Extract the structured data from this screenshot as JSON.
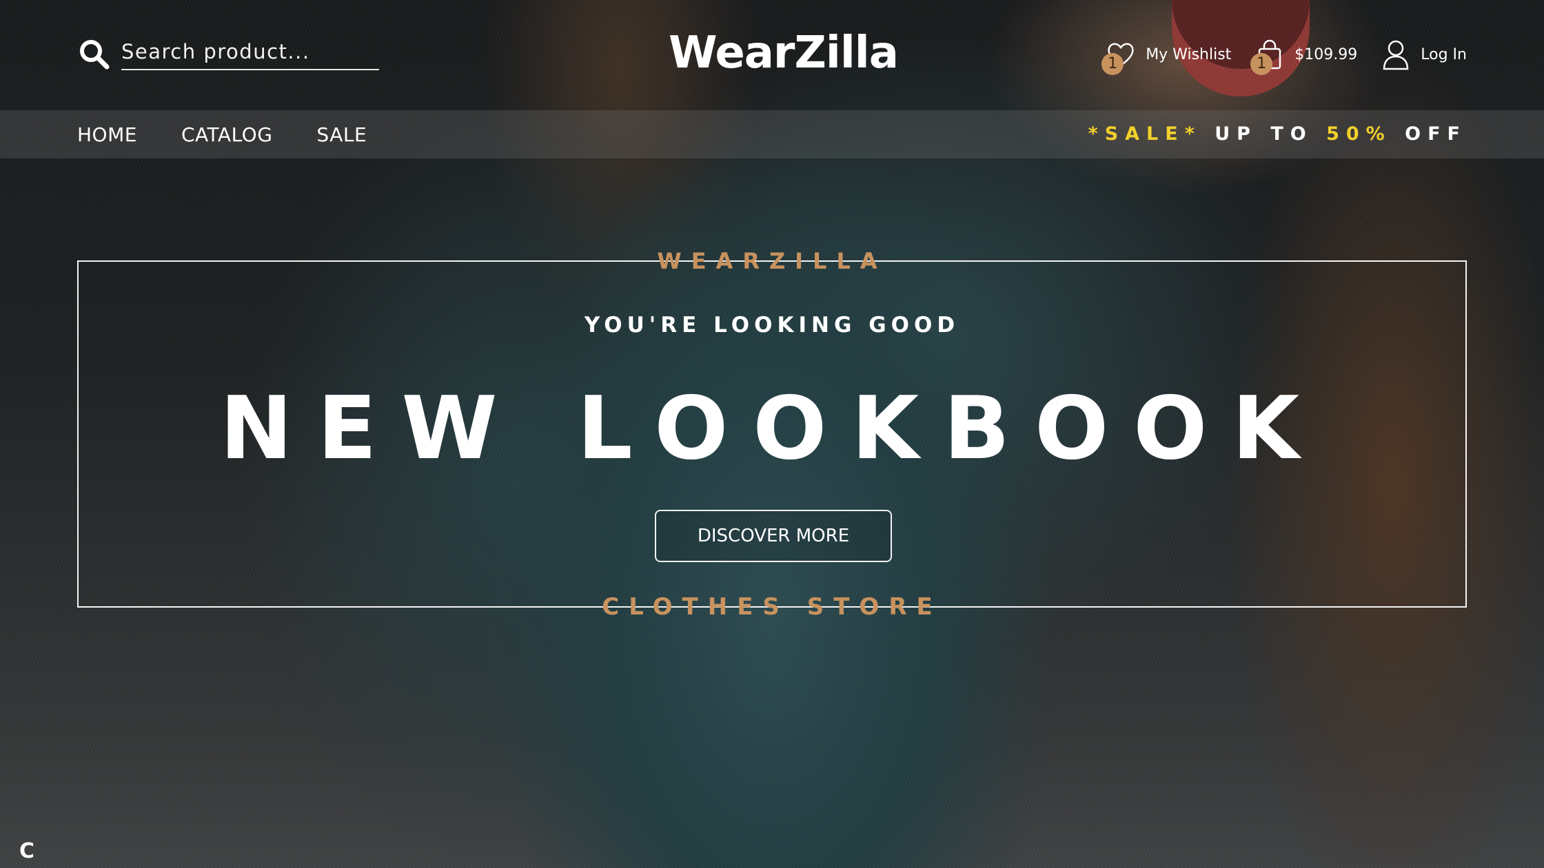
{
  "header": {
    "search_placeholder": "Search product...",
    "logo": "WearZilla",
    "wishlist": {
      "label": "My Wishlist",
      "count": "1",
      "icon": "heart-icon"
    },
    "cart": {
      "total": "$109.99",
      "count": "1",
      "icon": "shopping-bag-icon"
    },
    "login": {
      "label": "Log In",
      "icon": "user-icon"
    }
  },
  "nav": {
    "items": [
      "HOME",
      "CATALOG",
      "SALE"
    ],
    "promo": {
      "sale": "*SALE*",
      "up_to": "UP TO",
      "percent": "50%",
      "off": "OFF"
    }
  },
  "hero": {
    "brand": "WEARZILLA",
    "kicker": "YOU'RE LOOKING GOOD",
    "headline": "NEW LOOKBOOK",
    "cta": "DISCOVER MORE",
    "footer_label": "CLOTHES STORE"
  },
  "corner_glyph": "C",
  "colors": {
    "accent": "#c8925e",
    "promo_yellow": "#f3d02a",
    "text": "#ffffff"
  }
}
